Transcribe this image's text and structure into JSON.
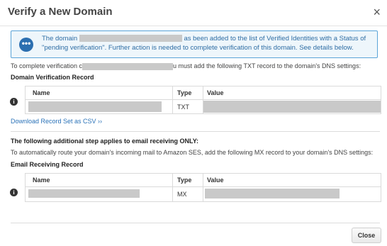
{
  "dialog": {
    "title": "Verify a New Domain",
    "close_symbol": "×"
  },
  "info": {
    "icon": "chat-bubble-icon",
    "text_before": "The domain",
    "text_after": "as been added to the list of Verified Identities with a Status of \"pending verification\". Further action is needed to complete verification of this domain. See details below."
  },
  "instructions": {
    "verification_before": "To complete verification c",
    "verification_after": "u must add the following TXT record to the domain's DNS settings:"
  },
  "verification_section": {
    "heading": "Domain Verification Record",
    "columns": [
      "Name",
      "Type",
      "Value"
    ],
    "row": {
      "type": "TXT"
    }
  },
  "download_link": "Download Record Set as CSV ››",
  "email_section": {
    "heading": "The following additional step applies to email receiving ONLY:",
    "description": "To automatically route your domain's incoming mail to Amazon SES, add the following MX record to your domain's DNS settings:",
    "subheading": "Email Receiving Record",
    "columns": [
      "Name",
      "Type",
      "Value"
    ],
    "row": {
      "type": "MX"
    }
  },
  "footer": {
    "close_label": "Close"
  }
}
